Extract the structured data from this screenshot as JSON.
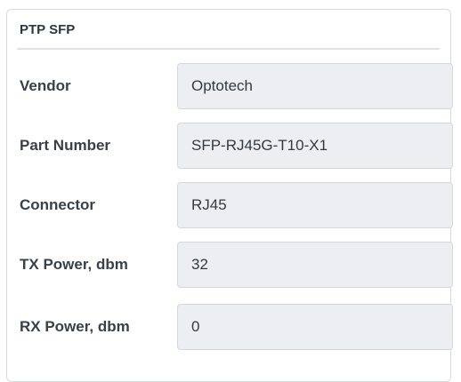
{
  "panel": {
    "title": "PTP SFP"
  },
  "fields": [
    {
      "label": "Vendor",
      "value": "Optotech"
    },
    {
      "label": "Part Number",
      "value": "SFP-RJ45G-T10-X1"
    },
    {
      "label": "Connector",
      "value": "RJ45"
    },
    {
      "label": "TX Power, dbm",
      "value": "32"
    },
    {
      "label": "RX Power, dbm",
      "value": "0"
    }
  ]
}
